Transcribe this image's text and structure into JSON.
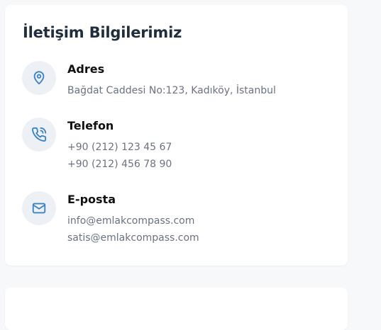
{
  "contact": {
    "title": "İletişim Bilgilerimiz",
    "accent_color": "#3b82c4",
    "items": [
      {
        "icon": "map-pin-icon",
        "label": "Adres",
        "lines": [
          "Bağdat Caddesi No:123, Kadıköy, İstanbul"
        ]
      },
      {
        "icon": "phone-icon",
        "label": "Telefon",
        "lines": [
          "+90 (212) 123 45 67",
          "+90 (212) 456 78 90"
        ]
      },
      {
        "icon": "mail-icon",
        "label": "E-posta",
        "lines": [
          "info@emlakcompass.com",
          "satis@emlakcompass.com"
        ]
      }
    ]
  }
}
